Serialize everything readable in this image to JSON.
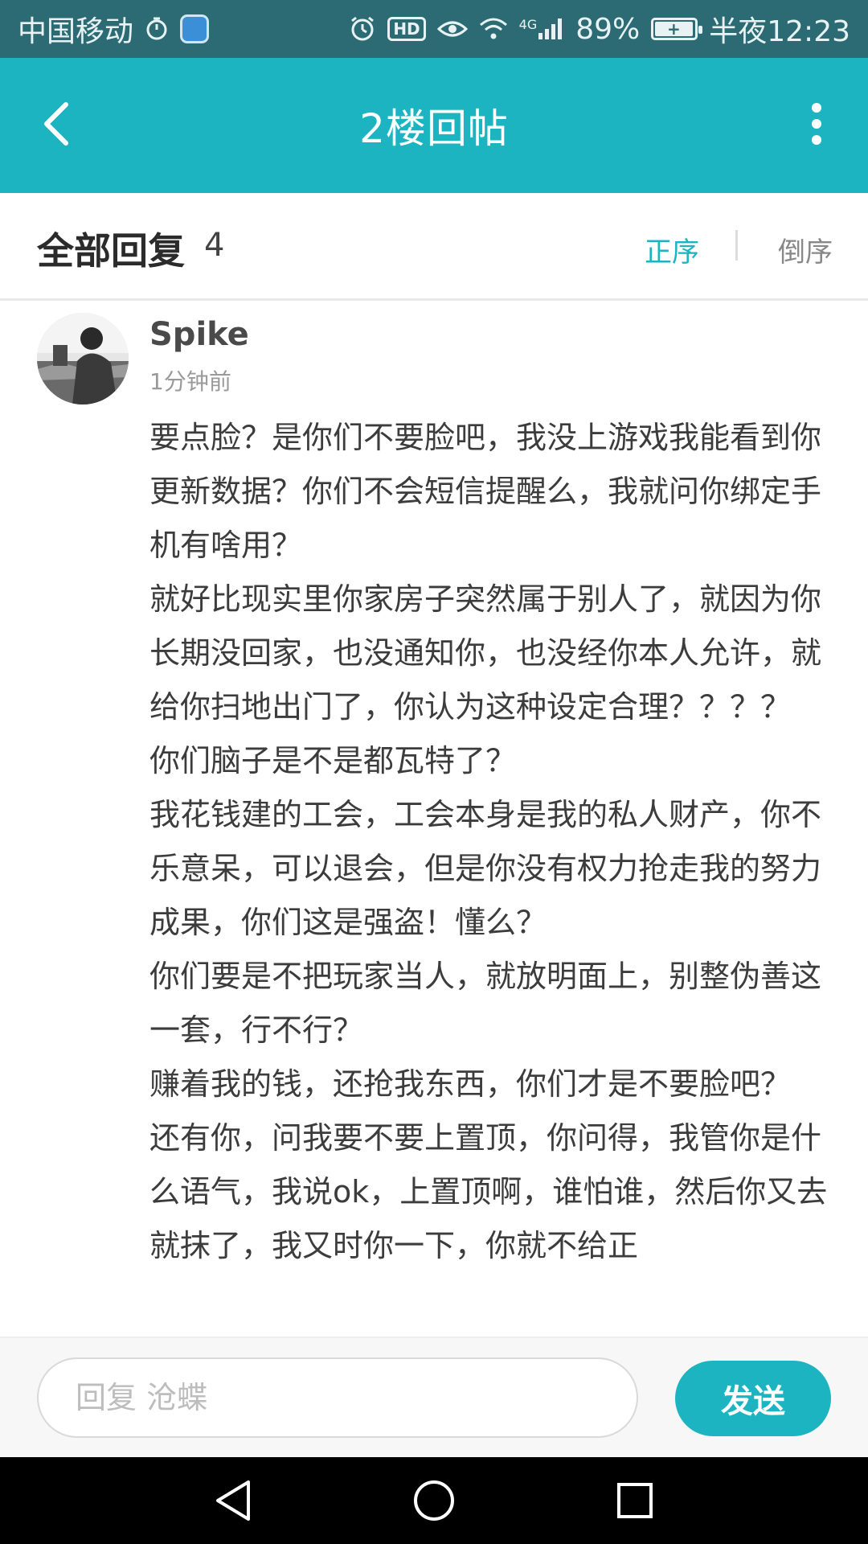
{
  "status_bar": {
    "carrier": "中国移动",
    "network": "4G",
    "battery_percent": "89%",
    "time": "半夜12:23",
    "hd_label": "HD"
  },
  "header": {
    "title": "2楼回帖"
  },
  "replies": {
    "title": "全部回复",
    "count": "4",
    "sort_asc": "正序",
    "sort_desc": "倒序"
  },
  "reply": {
    "author": "Spike",
    "time": "1分钟前",
    "paragraphs": [
      "要点脸？是你们不要脸吧，我没上游戏我能看到你更新数据？你们不会短信提醒么，我就问你绑定手机有啥用？",
      "就好比现实里你家房子突然属于别人了，就因为你长期没回家，也没通知你，也没经你本人允许，就给你扫地出门了，你认为这种设定合理？？？？",
      "你们脑子是不是都瓦特了？",
      "我花钱建的工会，工会本身是我的私人财产，你不乐意呆，可以退会，但是你没有权力抢走我的努力成果，你们这是强盗！懂么？",
      "你们要是不把玩家当人，就放明面上，别整伪善这一套，行不行？",
      "赚着我的钱，还抢我东西，你们才是不要脸吧？",
      "还有你，问我要不要上置顶，你问得，我管你是什么语气，我说ok，上置顶啊，谁怕谁，然后你又去就抹了，我又时你一下，你就不给正"
    ]
  },
  "reply_box": {
    "placeholder": "回复 沧蝶",
    "send_label": "发送"
  },
  "colors": {
    "accent": "#1db4c2",
    "status_bar": "#2c6b73"
  }
}
